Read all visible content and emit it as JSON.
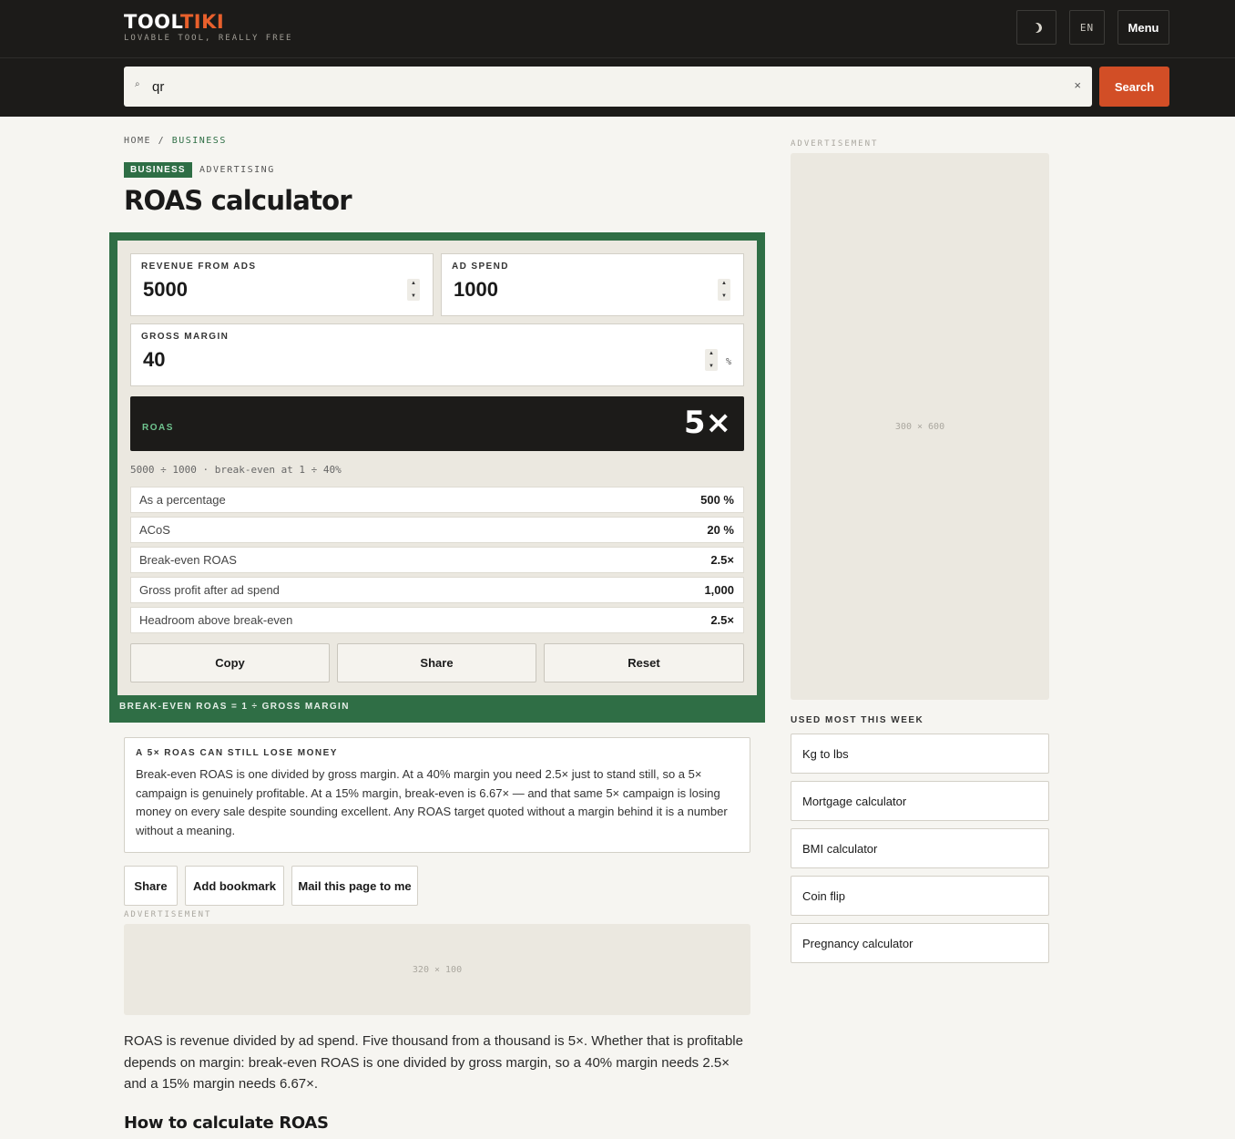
{
  "header": {
    "logo_main": "TOOL",
    "logo_accent": "TIKI",
    "tagline": "LOVABLE TOOL, REALLY FREE",
    "theme_icon": "moon-icon",
    "language": "EN",
    "menu_label": "Menu",
    "accent_color": "#e8602c"
  },
  "search": {
    "value": "qr",
    "search_icon": "search-icon",
    "clear_icon": "close-icon",
    "clear_glyph": "×",
    "button_label": "Search",
    "button_color": "#d24e26"
  },
  "breadcrumb": {
    "home": "HOME",
    "separator": "/",
    "current": "BUSINESS"
  },
  "tags": {
    "primary": "BUSINESS",
    "secondary": "ADVERTISING",
    "primary_color": "#2e6e45"
  },
  "page_title": "ROAS calculator",
  "calculator": {
    "frame_color": "#2f6e45",
    "fields": {
      "revenue": {
        "label": "REVENUE FROM ADS",
        "value": "5000"
      },
      "ad_spend": {
        "label": "AD SPEND",
        "value": "1000"
      },
      "gross_margin": {
        "label": "GROSS MARGIN",
        "value": "40",
        "unit": "%"
      }
    },
    "result": {
      "label": "ROAS",
      "value": "5×"
    },
    "formula": "5000 ÷ 1000 · break-even at 1 ÷ 40%",
    "stats": [
      {
        "label": "As a percentage",
        "value": "500 %"
      },
      {
        "label": "ACoS",
        "value": "20 %"
      },
      {
        "label": "Break-even ROAS",
        "value": "2.5×"
      },
      {
        "label": "Gross profit after ad spend",
        "value": "1,000"
      },
      {
        "label": "Headroom above break-even",
        "value": "2.5×"
      }
    ],
    "actions": {
      "copy": "Copy",
      "share": "Share",
      "reset": "Reset"
    },
    "footer": "BREAK-EVEN ROAS = 1 ÷ GROSS MARGIN"
  },
  "note": {
    "title": "A 5× ROAS CAN STILL LOSE MONEY",
    "body": "Break-even ROAS is one divided by gross margin. At a 40% margin you need 2.5× just to stand still, so a 5× campaign is genuinely profitable. At a 15% margin, break-even is 6.67× — and that same 5× campaign is losing money on every sale despite sounding excellent. Any ROAS target quoted without a margin behind it is a number without a meaning."
  },
  "page_actions": {
    "share": "Share",
    "bookmark": "Add bookmark",
    "mail": "Mail this page to me"
  },
  "ads": {
    "label": "ADVERTISEMENT",
    "inline_size": "320 × 100",
    "sidebar_size": "300 × 600"
  },
  "intro": "ROAS is revenue divided by ad spend. Five thousand from a thousand is 5×. Whether that is profitable depends on margin: break-even ROAS is one divided by gross margin, so a 40% margin needs 2.5× and a 15% margin needs 6.67×.",
  "how_to_heading": "How to calculate ROAS",
  "sidebar": {
    "popular_title": "USED MOST THIS WEEK",
    "popular": [
      {
        "label": "Kg to lbs"
      },
      {
        "label": "Mortgage calculator"
      },
      {
        "label": "BMI calculator"
      },
      {
        "label": "Coin flip"
      },
      {
        "label": "Pregnancy calculator"
      }
    ]
  }
}
